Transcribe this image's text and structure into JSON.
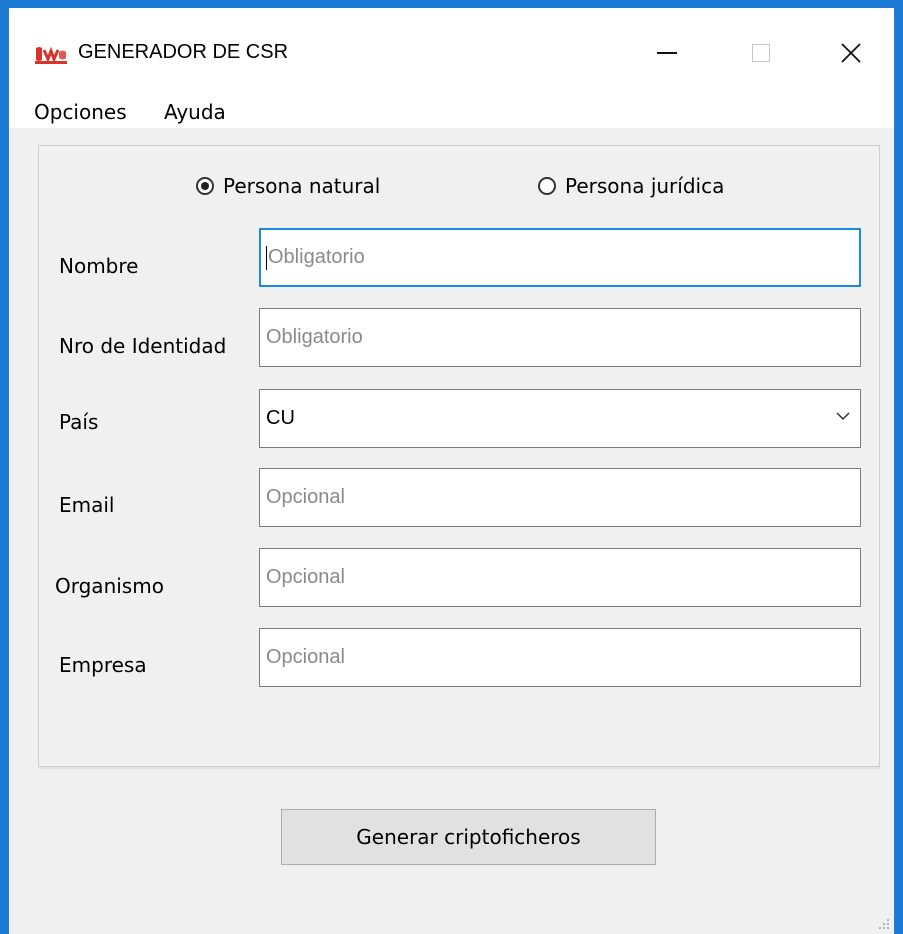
{
  "window": {
    "title": "GENERADOR DE CSR",
    "icon": "app-logo-icon",
    "controls": [
      "minimize-icon",
      "maximize-icon",
      "close-icon"
    ],
    "accent": "#1e88e5"
  },
  "menu": {
    "opciones": "Opciones",
    "ayuda": "Ayuda"
  },
  "person_type": {
    "natural": {
      "label": "Persona natural",
      "checked": true
    },
    "juridica": {
      "label": "Persona jurídica",
      "checked": false
    }
  },
  "form": {
    "nombre": {
      "label": "Nombre",
      "placeholder": "Obligatorio",
      "value": ""
    },
    "identidad": {
      "label": "Nro de Identidad",
      "placeholder": "Obligatorio",
      "value": ""
    },
    "pais": {
      "label": "País",
      "value": "CU"
    },
    "email": {
      "label": "Email",
      "placeholder": "Opcional",
      "value": ""
    },
    "organismo": {
      "label": "Organismo",
      "placeholder": "Opcional",
      "value": ""
    },
    "empresa": {
      "label": "Empresa",
      "placeholder": "Opcional",
      "value": ""
    }
  },
  "actions": {
    "generate": "Generar criptoficheros"
  }
}
